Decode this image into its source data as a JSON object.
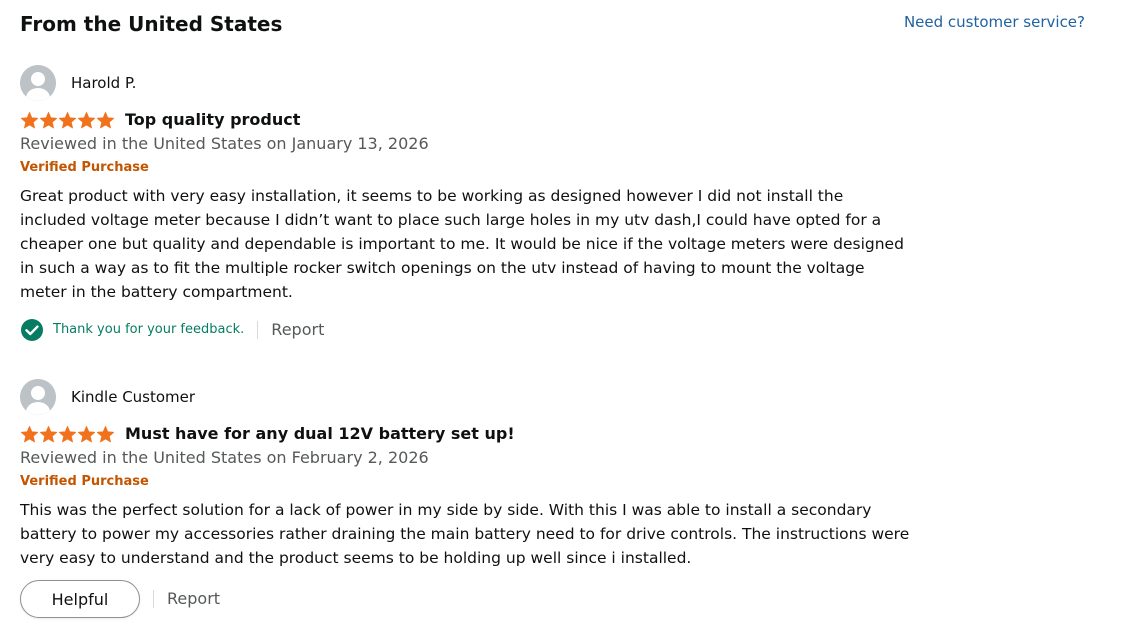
{
  "header": {
    "section_title": "From the United States",
    "help_link": "Need customer service?"
  },
  "colors": {
    "star": "#f2711c",
    "verified": "#c45500",
    "link": "#2162a1",
    "success": "#067d62",
    "secondary_text": "#565959"
  },
  "reviews": [
    {
      "author": "Harold P.",
      "rating": 5,
      "rating_max": 5,
      "title": "Top quality product",
      "date": "Reviewed in the United States on January 13, 2026",
      "verified": "Verified Purchase",
      "body": "Great product with very easy installation, it seems to be working as designed however I did not install the included voltage meter because I didn’t want to place such large holes in my utv dash,I could have opted for a cheaper one but quality and dependable is important to me. It would be nice if the voltage meters were designed in such a way as to fit the multiple rocker switch openings on the utv instead of having to mount the voltage meter in the battery compartment.",
      "feedback_message": "Thank you for your feedback.",
      "report_label": "Report"
    },
    {
      "author": "Kindle Customer",
      "rating": 5,
      "rating_max": 5,
      "title": "Must have for any dual 12V battery set up!",
      "date": "Reviewed in the United States on February 2, 2026",
      "verified": "Verified Purchase",
      "body": "This was the perfect solution for a lack of power in my side by side. With this I was able to install a secondary battery to power my accessories rather draining the main battery need to for drive controls. The instructions were very easy to understand and the product seems to be holding up well since i installed.",
      "helpful_label": "Helpful",
      "report_label": "Report"
    }
  ]
}
